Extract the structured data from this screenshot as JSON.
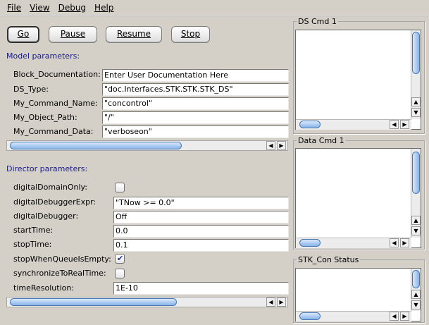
{
  "menu": [
    "File",
    "View",
    "Debug",
    "Help"
  ],
  "buttons": {
    "go": "Go",
    "pause": "Pause",
    "resume": "Resume",
    "stop": "Stop"
  },
  "model": {
    "title": "Model parameters:",
    "params": [
      {
        "label": "Block_Documentation:",
        "value": "Enter User Documentation Here"
      },
      {
        "label": "DS_Type:",
        "value": "\"doc.Interfaces.STK.STK.STK_DS\""
      },
      {
        "label": "My_Command_Name:",
        "value": "\"concontrol\""
      },
      {
        "label": "My_Object_Path:",
        "value": "\"/\""
      },
      {
        "label": "My_Command_Data:",
        "value": "\"verboseon\""
      }
    ]
  },
  "director": {
    "title": "Director parameters:",
    "params": [
      {
        "label": "digitalDomainOnly:",
        "type": "checkbox",
        "checked": false
      },
      {
        "label": "digitalDebuggerExpr:",
        "type": "text",
        "value": "\"TNow >= 0.0\""
      },
      {
        "label": "digitalDebugger:",
        "type": "text",
        "value": "Off"
      },
      {
        "label": "startTime:",
        "type": "text",
        "value": "0.0"
      },
      {
        "label": "stopTime:",
        "type": "text",
        "value": "0.1"
      },
      {
        "label": "stopWhenQueueIsEmpty:",
        "type": "checkbox",
        "checked": true
      },
      {
        "label": "synchronizeToRealTime:",
        "type": "checkbox",
        "checked": false
      },
      {
        "label": "timeResolution:",
        "type": "text",
        "value": "1E-10"
      }
    ]
  },
  "panels": {
    "ds_cmd": "DS Cmd 1",
    "data_cmd": "Data Cmd 1",
    "stk_status": "STK_Con Status"
  },
  "icons": {
    "check": "checkmark-icon",
    "left": "arrow-left-icon",
    "right": "arrow-right-icon",
    "up": "arrow-up-icon",
    "down": "arrow-down-icon"
  },
  "colors": {
    "section_title": "#1a1a8c",
    "scroll_thumb": "#88b4e8",
    "background": "#d4d0c8"
  }
}
